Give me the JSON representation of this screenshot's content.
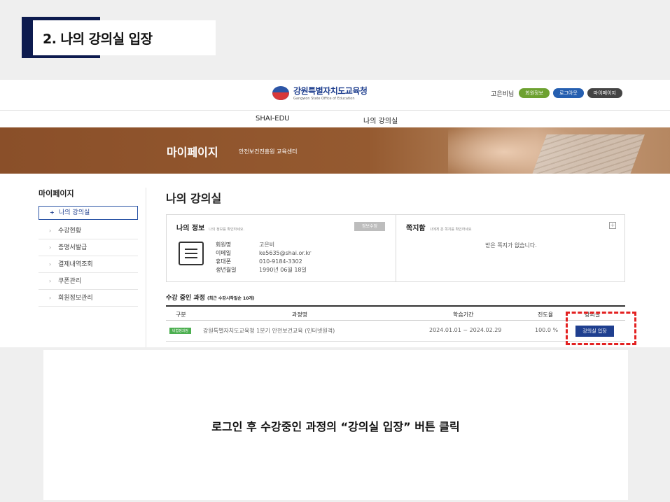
{
  "slide": {
    "title": "2. 나의 강의실 입장"
  },
  "header": {
    "logo_ko": "강원특별자치도교육청",
    "logo_en": "Gangwon State Office of Education",
    "user_name": "고은비님",
    "btn_member_info": "회원정보",
    "btn_logout": "로그아웃",
    "btn_mypage": "마이페이지"
  },
  "gnb": {
    "menu1": "SHAI-EDU",
    "menu2": "나의 강의실"
  },
  "banner": {
    "title": "마이페이지",
    "subtitle": "안전보건진흥원 교육센터"
  },
  "sidebar": {
    "title": "마이페이지",
    "items": [
      {
        "label": "나의 강의실"
      },
      {
        "label": "수강현황"
      },
      {
        "label": "증명서발급"
      },
      {
        "label": "결제내역조회"
      },
      {
        "label": "쿠폰관리"
      },
      {
        "label": "회원정보관리"
      }
    ]
  },
  "main": {
    "title": "나의 강의실",
    "my_info": {
      "heading": "나의 정보",
      "note": "나의 정보를 확인하세요.",
      "edit_label": "정보수정",
      "rows": [
        {
          "key": "회원명",
          "value": "고은비"
        },
        {
          "key": "이메일",
          "value": "ke5635@shai.or.kr"
        },
        {
          "key": "휴대폰",
          "value": "010-9184-3302"
        },
        {
          "key": "생년월일",
          "value": "1990년 06월 18일"
        }
      ]
    },
    "messages": {
      "heading": "쪽지함",
      "note": "나에게 온 쪽지를 확인하세요",
      "empty": "받은 쪽지가 없습니다."
    },
    "courses": {
      "heading": "수강 중인 과정",
      "sub": "(최근 수강시작일순 10개)",
      "columns": [
        "구분",
        "과정명",
        "학습기간",
        "진도율",
        "강의실"
      ],
      "rows": [
        {
          "tag": "비법정과정",
          "name": "강원특별자치도교육청 1분기 안전보건교육 (인터넷원격)",
          "period": "2024.01.01 ~ 2024.02.29",
          "progress": "100.0 %",
          "action": "강의실 입장"
        }
      ]
    }
  },
  "caption": "로그인 후 수강중인 과정의 “강의실 입장” 버튼 클릭",
  "colors": {
    "navy": "#0d1b4f",
    "brand_blue": "#1f3f8f",
    "highlight": "#e32121",
    "banner": "#955a30"
  }
}
